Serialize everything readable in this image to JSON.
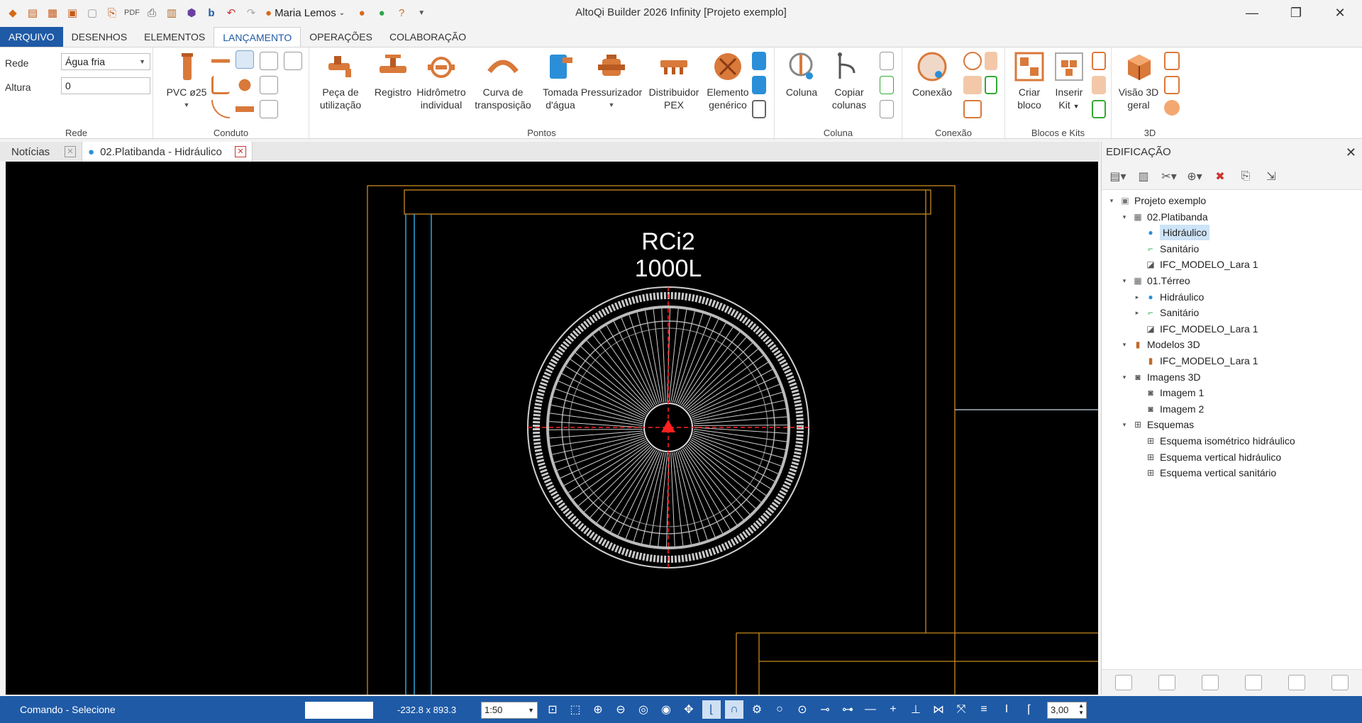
{
  "window": {
    "title": "AltoQi Builder 2026 Infinity [Projeto exemplo]",
    "user": "Maria Lemos"
  },
  "menu": {
    "items": [
      {
        "label": "ARQUIVO"
      },
      {
        "label": "DESENHOS"
      },
      {
        "label": "ELEMENTOS"
      },
      {
        "label": "LANÇAMENTO"
      },
      {
        "label": "OPERAÇÕES"
      },
      {
        "label": "COLABORAÇÃO"
      }
    ]
  },
  "ribbon": {
    "rede": {
      "group_label": "Rede",
      "rede_label": "Rede",
      "rede_value": "Água fria",
      "altura_label": "Altura",
      "altura_value": "0"
    },
    "conduto": {
      "group_label": "Conduto",
      "pvc_label": "PVC ø25"
    },
    "pontos": {
      "group_label": "Pontos",
      "buttons": [
        {
          "label1": "Peça de",
          "label2": "utilização"
        },
        {
          "label1": "Registro",
          "label2": ""
        },
        {
          "label1": "Hidrômetro",
          "label2": "individual"
        },
        {
          "label1": "Curva de",
          "label2": "transposição"
        },
        {
          "label1": "Tomada",
          "label2": "d'água"
        },
        {
          "label1": "Pressurizador",
          "label2": ""
        },
        {
          "label1": "Distribuidor",
          "label2": "PEX"
        },
        {
          "label1": "Elemento",
          "label2": "genérico"
        }
      ]
    },
    "coluna": {
      "group_label": "Coluna",
      "buttons": [
        {
          "label1": "Coluna",
          "label2": ""
        },
        {
          "label1": "Copiar",
          "label2": "colunas"
        }
      ]
    },
    "conexao": {
      "group_label": "Conexão",
      "button": "Conexão"
    },
    "blocos": {
      "group_label": "Blocos e Kits",
      "buttons": [
        {
          "label1": "Criar",
          "label2": "bloco"
        },
        {
          "label1": "Inserir",
          "label2": "Kit"
        }
      ]
    },
    "tres_d": {
      "group_label": "3D",
      "button1": "Visão 3D",
      "button2": "geral"
    }
  },
  "tabs": [
    {
      "label": "Notícias"
    },
    {
      "label": "02.Platibanda - Hidráulico"
    }
  ],
  "drawing": {
    "tank_label_1": "RCi2",
    "tank_label_2": "1000L"
  },
  "panel": {
    "title": "EDIFICAÇÃO",
    "tree": [
      {
        "label": "Projeto exemplo",
        "icon": "project-icon"
      },
      {
        "label": "02.Platibanda",
        "icon": "floor-icon"
      },
      {
        "label": "Hidráulico",
        "icon": "water-drop-icon"
      },
      {
        "label": "Sanitário",
        "icon": "sanitary-icon"
      },
      {
        "label": "IFC_MODELO_Lara 1",
        "icon": "ifc-icon"
      },
      {
        "label": "01.Térreo",
        "icon": "floor-icon"
      },
      {
        "label": "Hidráulico",
        "icon": "water-drop-icon"
      },
      {
        "label": "Sanitário",
        "icon": "sanitary-icon"
      },
      {
        "label": "IFC_MODELO_Lara 1",
        "icon": "ifc-icon"
      },
      {
        "label": "Modelos 3D",
        "icon": "model-3d-icon"
      },
      {
        "label": "IFC_MODELO_Lara 1",
        "icon": "model-3d-icon"
      },
      {
        "label": "Imagens 3D",
        "icon": "camera-icon"
      },
      {
        "label": "Imagem 1",
        "icon": "camera-icon"
      },
      {
        "label": "Imagem 2",
        "icon": "camera-icon"
      },
      {
        "label": "Esquemas",
        "icon": "schema-icon"
      },
      {
        "label": "Esquema isométrico hidráulico",
        "icon": "schema-icon"
      },
      {
        "label": "Esquema vertical hidráulico",
        "icon": "schema-icon"
      },
      {
        "label": "Esquema vertical sanitário",
        "icon": "schema-icon"
      }
    ]
  },
  "status": {
    "command": "Comando - Selecione",
    "coords": "-232.8 x 893.3",
    "scale": "1:50",
    "spin_value": "3,00"
  }
}
